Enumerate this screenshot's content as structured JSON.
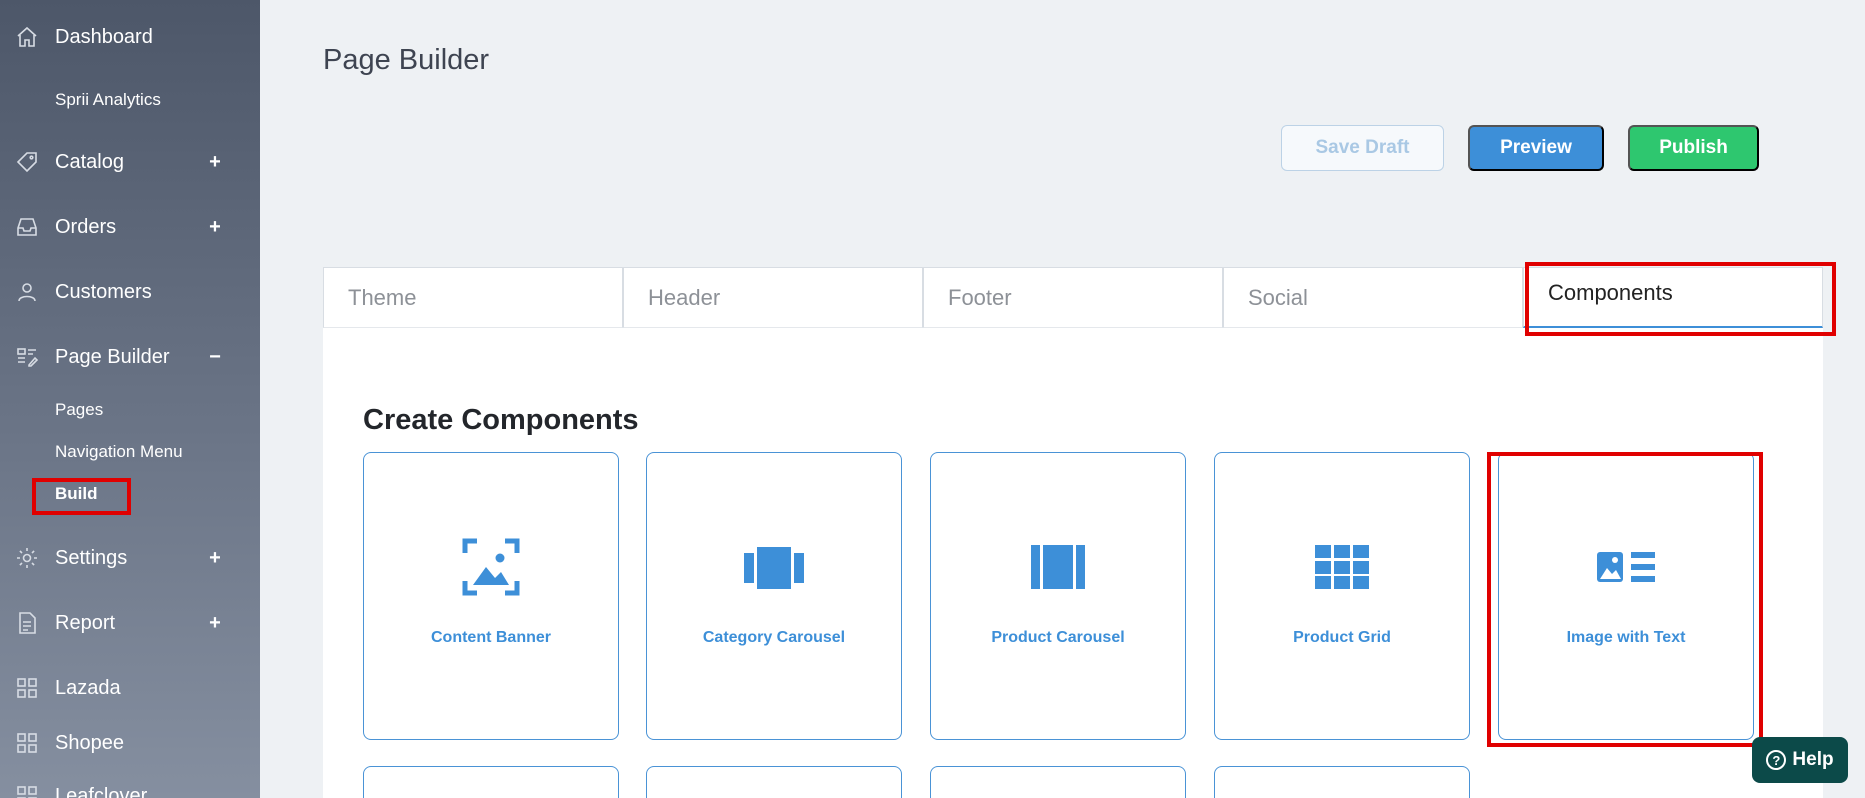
{
  "sidebar": {
    "items": [
      {
        "label": "Dashboard",
        "icon": "home-icon",
        "toggle": ""
      },
      {
        "label": "Catalog",
        "icon": "tag-icon",
        "toggle": "+"
      },
      {
        "label": "Orders",
        "icon": "inbox-icon",
        "toggle": "+"
      },
      {
        "label": "Customers",
        "icon": "user-icon",
        "toggle": ""
      },
      {
        "label": "Page Builder",
        "icon": "page-builder-icon",
        "toggle": "−"
      },
      {
        "label": "Settings",
        "icon": "gear-icon",
        "toggle": "+"
      },
      {
        "label": "Report",
        "icon": "document-icon",
        "toggle": "+"
      },
      {
        "label": "Lazada",
        "icon": "grid-icon",
        "toggle": ""
      },
      {
        "label": "Shopee",
        "icon": "grid-icon",
        "toggle": ""
      },
      {
        "label": "Leafclover",
        "icon": "grid-icon",
        "toggle": ""
      }
    ],
    "dashboard_sub": "Sprii Analytics",
    "page_builder_sub": [
      "Pages",
      "Navigation Menu",
      "Build"
    ]
  },
  "main": {
    "title": "Page Builder",
    "buttons": {
      "save_draft": "Save Draft",
      "preview": "Preview",
      "publish": "Publish"
    },
    "tabs": [
      "Theme",
      "Header",
      "Footer",
      "Social",
      "Components"
    ],
    "section_title": "Create Components",
    "components": [
      {
        "label": "Content Banner",
        "icon": "image-frame-icon"
      },
      {
        "label": "Category Carousel",
        "icon": "carousel-icon"
      },
      {
        "label": "Product Carousel",
        "icon": "columns-icon"
      },
      {
        "label": "Product Grid",
        "icon": "grid-icon"
      },
      {
        "label": "Image with Text",
        "icon": "image-text-icon"
      }
    ]
  },
  "help": {
    "label": "Help"
  },
  "colors": {
    "accent": "#3d8fd8",
    "publish": "#2ec76f",
    "highlight": "#e00000",
    "help_bg": "#0c4a49"
  }
}
